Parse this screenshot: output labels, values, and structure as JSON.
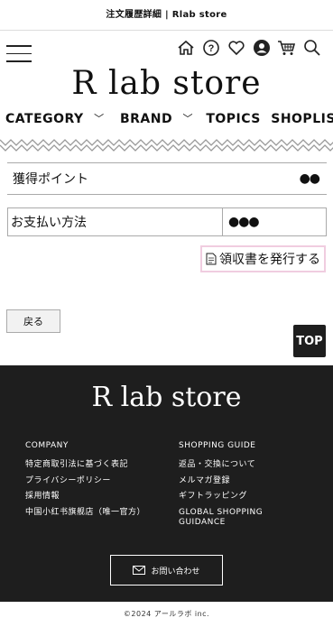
{
  "title_bar": "注文履歴詳細 | Rlab store",
  "header": {
    "logo": "R lab store",
    "icons": [
      "home-icon",
      "help-icon",
      "heart-icon",
      "account-icon",
      "cart-icon",
      "search-icon"
    ]
  },
  "nav": {
    "category": "CATEGORY",
    "brand": "BRAND",
    "topics": "TOPICS",
    "shoplist": "SHOPLIST"
  },
  "points": {
    "label": "獲得ポイント",
    "value": "●●"
  },
  "payment": {
    "label": "お支払い方法",
    "value": "●●●"
  },
  "receipt_label": "領収書を発行する",
  "back_label": "戻る",
  "top_label": "TOP",
  "footer": {
    "logo": "R lab store",
    "left_head": "COMPANY",
    "left_items": [
      "特定商取引法に基づく表記",
      "プライバシーポリシー",
      "採用情報",
      "中国小红书旗舰店（唯一官方）"
    ],
    "right_head": "SHOPPING GUIDE",
    "right_items": [
      "返品・交換について",
      "メルマガ登録",
      "ギフトラッピング",
      "GLOBAL SHOPPING GUIDANCE"
    ],
    "contact_label": "お問い合わせ"
  },
  "copyright": "©2024 アールラボ inc."
}
